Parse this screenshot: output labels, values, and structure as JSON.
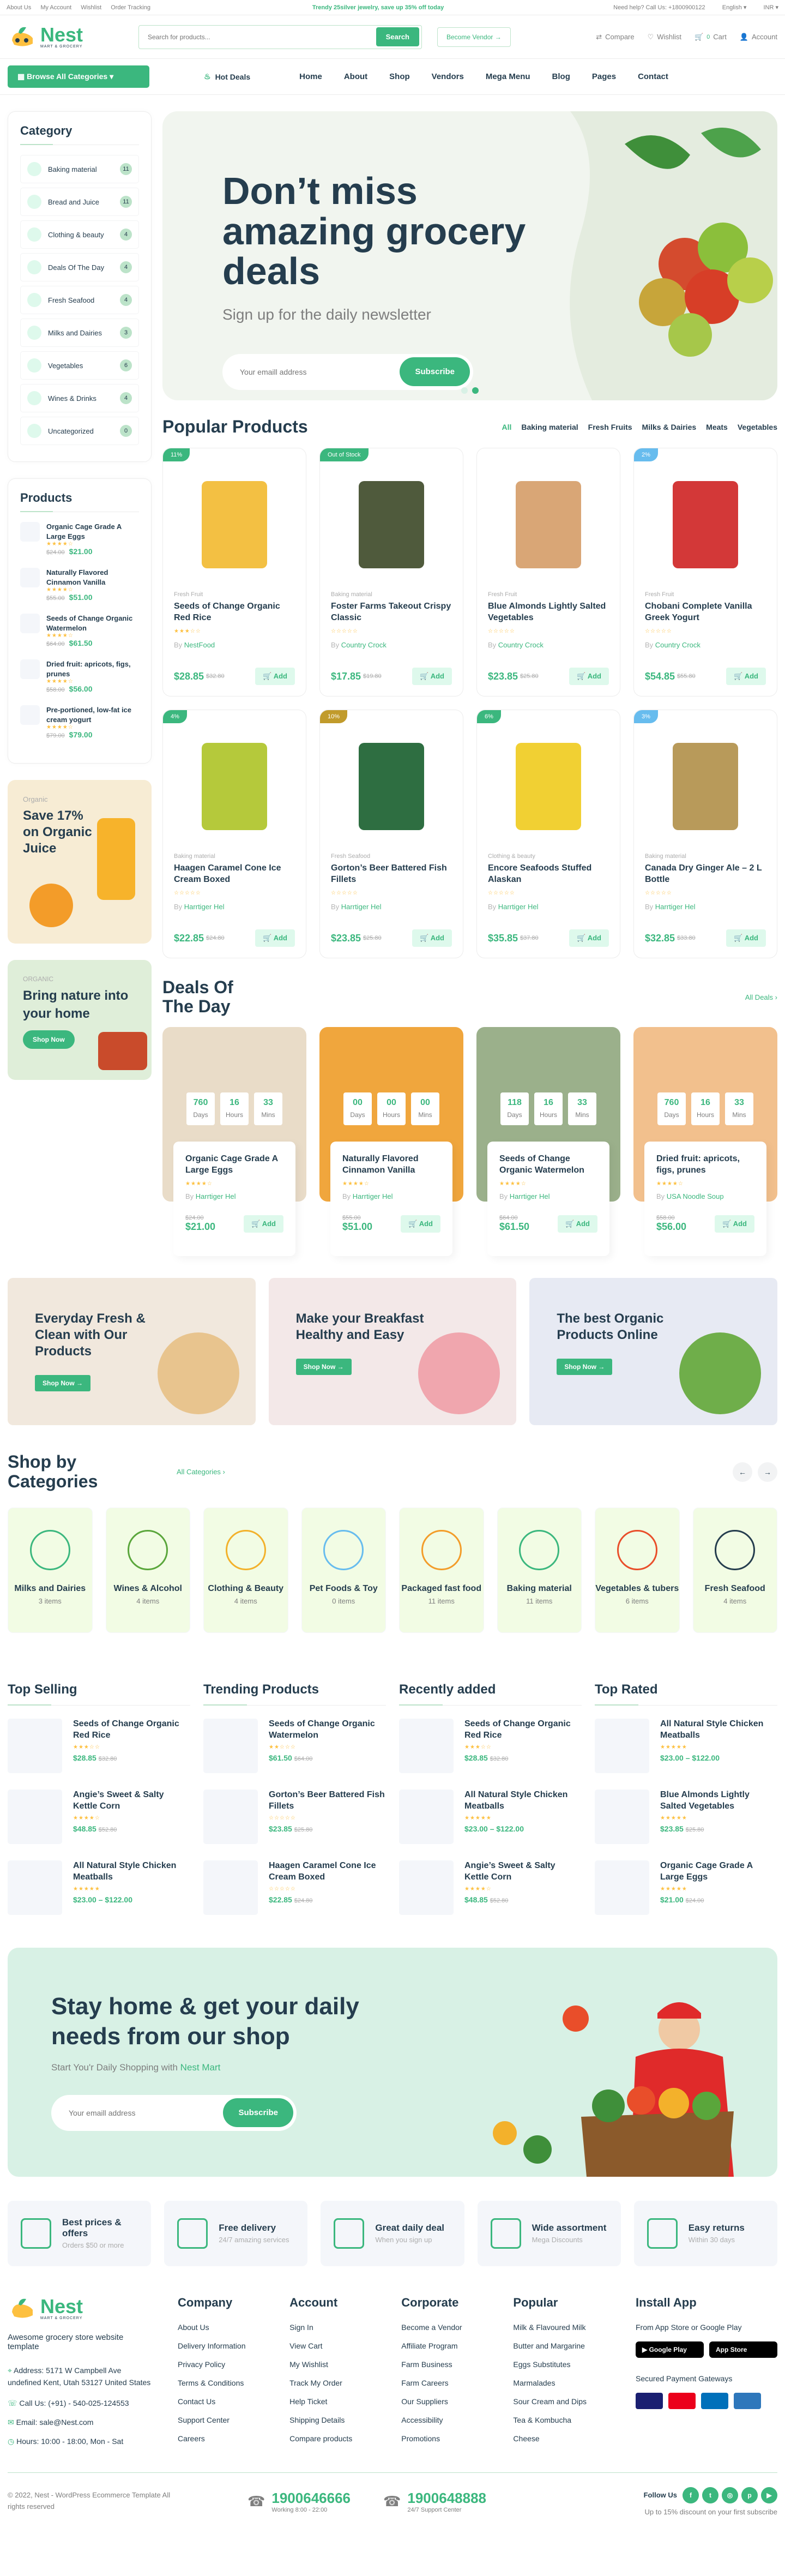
{
  "topbar": {
    "links": [
      "About Us",
      "My Account",
      "Wishlist",
      "Order Tracking"
    ],
    "promo": "Trendy 25silver jewelry, save up 35% off today",
    "help": "Need help? Call Us: +1800900122",
    "lang": "English",
    "currency": "INR"
  },
  "header": {
    "logo": "Nest",
    "logo_sub": "MART & GROCERY",
    "search_placeholder": "Search for products...",
    "search_btn": "Search",
    "vendor_btn": "Become Vendor",
    "actions": [
      {
        "label": "Compare",
        "icon": "compare-icon"
      },
      {
        "label": "Wishlist",
        "icon": "heart-icon"
      },
      {
        "label": "Cart",
        "icon": "cart-icon",
        "count": "0"
      },
      {
        "label": "Account",
        "icon": "user-icon"
      }
    ]
  },
  "nav": {
    "browse": "Browse All Categories",
    "hot": "Hot Deals",
    "items": [
      "Home",
      "About",
      "Shop",
      "Vendors",
      "Mega Menu",
      "Blog",
      "Pages",
      "Contact"
    ]
  },
  "sidebar": {
    "category_title": "Category",
    "categories": [
      {
        "label": "Baking material",
        "count": "11"
      },
      {
        "label": "Bread and Juice",
        "count": "11"
      },
      {
        "label": "Clothing & beauty",
        "count": "4"
      },
      {
        "label": "Deals Of The Day",
        "count": "4"
      },
      {
        "label": "Fresh Seafood",
        "count": "4"
      },
      {
        "label": "Milks and Dairies",
        "count": "3"
      },
      {
        "label": "Vegetables",
        "count": "6"
      },
      {
        "label": "Wines & Drinks",
        "count": "4"
      },
      {
        "label": "Uncategorized",
        "count": "0"
      }
    ],
    "products_title": "Products",
    "products": [
      {
        "name": "Organic Cage Grade A Large Eggs",
        "old": "$24.00",
        "price": "$21.00"
      },
      {
        "name": "Naturally Flavored Cinnamon Vanilla",
        "old": "$55.00",
        "price": "$51.00"
      },
      {
        "name": "Seeds of Change Organic Watermelon",
        "old": "$64.00",
        "price": "$61.50"
      },
      {
        "name": "Dried fruit: apricots, figs, prunes",
        "old": "$58.00",
        "price": "$56.00"
      },
      {
        "name": "Pre-portioned, low-fat ice cream yogurt",
        "old": "$79.00",
        "price": "$79.00"
      }
    ],
    "promo1": {
      "small": "Organic",
      "title": "Save 17% on Organic Juice"
    },
    "promo2": {
      "small": "ORGANIC",
      "title": "Bring nature into your home",
      "btn": "Shop Now"
    }
  },
  "hero": {
    "title": "Don’t miss amazing grocery deals",
    "subtitle": "Sign up for the daily newsletter",
    "placeholder": "Your emaill address",
    "btn": "Subscribe"
  },
  "popular": {
    "title": "Popular Products",
    "filters": [
      "All",
      "Baking material",
      "Fresh Fruits",
      "Milks & Dairies",
      "Meats",
      "Vegetables"
    ],
    "products": [
      {
        "badge": "11%",
        "badge_color": "#3bb77e",
        "cat": "Fresh Fruit",
        "name": "Seeds of Change Organic Red Rice",
        "stars": "★★★☆☆",
        "by": "NestFood",
        "price": "$28.85",
        "old": "$32.80",
        "pkg": "#f3c043"
      },
      {
        "badge": "Out of Stock",
        "badge_color": "#3bb77e",
        "cat": "Baking material",
        "name": "Foster Farms Takeout Crispy Classic",
        "stars": "☆☆☆☆☆",
        "by": "Country Crock",
        "price": "$17.85",
        "old": "$19.80",
        "pkg": "#4f5a3c"
      },
      {
        "badge": "",
        "badge_color": "",
        "cat": "Fresh Fruit",
        "name": "Blue Almonds Lightly Salted Vegetables",
        "stars": "☆☆☆☆☆",
        "by": "Country Crock",
        "price": "$23.85",
        "old": "$25.80",
        "pkg": "#d9a676"
      },
      {
        "badge": "2%",
        "badge_color": "#67bcee",
        "cat": "Fresh Fruit",
        "name": "Chobani Complete Vanilla Greek Yogurt",
        "stars": "☆☆☆☆☆",
        "by": "Country Crock",
        "price": "$54.85",
        "old": "$55.80",
        "pkg": "#d33838"
      },
      {
        "badge": "4%",
        "badge_color": "#3bb77e",
        "cat": "Baking material",
        "name": "Haagen Caramel Cone Ice Cream Boxed",
        "stars": "☆☆☆☆☆",
        "by": "Harrtiger Hel",
        "price": "$22.85",
        "old": "$24.80",
        "pkg": "#b5c93b"
      },
      {
        "badge": "10%",
        "badge_color": "#c19b2b",
        "cat": "Fresh Seafood",
        "name": "Gorton’s Beer Battered Fish Fillets",
        "stars": "☆☆☆☆☆",
        "by": "Harrtiger Hel",
        "price": "$23.85",
        "old": "$25.80",
        "pkg": "#2e6e41"
      },
      {
        "badge": "6%",
        "badge_color": "#3bb77e",
        "cat": "Clothing & beauty",
        "name": "Encore Seafoods Stuffed Alaskan",
        "stars": "☆☆☆☆☆",
        "by": "Harrtiger Hel",
        "price": "$35.85",
        "old": "$37.80",
        "pkg": "#f1d033"
      },
      {
        "badge": "3%",
        "badge_color": "#67bcee",
        "cat": "Baking material",
        "name": "Canada Dry Ginger Ale – 2 L Bottle",
        "stars": "☆☆☆☆☆",
        "by": "Harrtiger Hel",
        "price": "$32.85",
        "old": "$33.80",
        "pkg": "#b89a5a"
      }
    ]
  },
  "deals": {
    "title": "Deals Of The Day",
    "link": "All Deals",
    "items": [
      {
        "d": "760",
        "h": "16",
        "m": "33",
        "name": "Organic Cage Grade A Large Eggs",
        "by": "Harrtiger Hel",
        "old": "$24.00",
        "price": "$21.00",
        "photo": "#e9dcc8"
      },
      {
        "d": "00",
        "h": "00",
        "m": "00",
        "name": "Naturally Flavored Cinnamon Vanilla",
        "by": "Harrtiger Hel",
        "old": "$55.00",
        "price": "$51.00",
        "photo": "#f0a63d"
      },
      {
        "d": "118",
        "h": "16",
        "m": "33",
        "name": "Seeds of Change Organic Watermelon",
        "by": "Harrtiger Hel",
        "old": "$64.00",
        "price": "$61.50",
        "photo": "#9bb08b"
      },
      {
        "d": "760",
        "h": "16",
        "m": "33",
        "name": "Dried fruit: apricots, figs, prunes",
        "by": "USA Noodle Soup",
        "old": "$58.00",
        "price": "$56.00",
        "photo": "#f2c08d"
      }
    ],
    "labels": {
      "days": "Days",
      "hours": "Hours",
      "mins": "Mins",
      "add": "Add",
      "by": "By"
    }
  },
  "banners": [
    {
      "title": "Everyday Fresh & Clean with Our Products",
      "btn": "Shop Now",
      "bg": "#f1e8dd"
    },
    {
      "title": "Make your Breakfast Healthy and Easy",
      "btn": "Shop Now",
      "bg": "#f3e8e8"
    },
    {
      "title": "The best Organic Products Online",
      "btn": "Shop Now",
      "bg": "#e7eaf3"
    }
  ],
  "shop_by": {
    "title": "Shop by Categories",
    "link": "All Categories",
    "items": [
      {
        "name": "Milks and Dairies",
        "count": "3 items",
        "bg": "#f2fce4"
      },
      {
        "name": "Wines & Alcohol",
        "count": "4 items",
        "bg": "#f2fce4"
      },
      {
        "name": "Clothing & Beauty",
        "count": "4 items",
        "bg": "#f2fce4"
      },
      {
        "name": "Pet Foods & Toy",
        "count": "0 items",
        "bg": "#f2fce4"
      },
      {
        "name": "Packaged fast food",
        "count": "11 items",
        "bg": "#f2fce4"
      },
      {
        "name": "Baking material",
        "count": "11 items",
        "bg": "#f2fce4"
      },
      {
        "name": "Vegetables & tubers",
        "count": "6 items",
        "bg": "#f2fce4"
      },
      {
        "name": "Fresh Seafood",
        "count": "4 items",
        "bg": "#f2fce4"
      }
    ]
  },
  "lists": [
    {
      "title": "Top Selling",
      "items": [
        {
          "name": "Seeds of Change Organic Red Rice",
          "price": "$28.85",
          "old": "$32.80",
          "stars": "★★★☆☆"
        },
        {
          "name": "Angie’s Sweet & Salty Kettle Corn",
          "price": "$48.85",
          "old": "$52.80",
          "stars": "★★★★☆"
        },
        {
          "name": "All Natural Style Chicken Meatballs",
          "price": "$23.00 – $122.00",
          "old": "",
          "stars": "★★★★★"
        }
      ]
    },
    {
      "title": "Trending Products",
      "items": [
        {
          "name": "Seeds of Change Organic Watermelon",
          "price": "$61.50",
          "old": "$64.00",
          "stars": "★★☆☆☆"
        },
        {
          "name": "Gorton’s Beer Battered Fish Fillets",
          "price": "$23.85",
          "old": "$25.80",
          "stars": "☆☆☆☆☆"
        },
        {
          "name": "Haagen Caramel Cone Ice Cream Boxed",
          "price": "$22.85",
          "old": "$24.80",
          "stars": "☆☆☆☆☆"
        }
      ]
    },
    {
      "title": "Recently added",
      "items": [
        {
          "name": "Seeds of Change Organic Red Rice",
          "price": "$28.85",
          "old": "$32.80",
          "stars": "★★★☆☆"
        },
        {
          "name": "All Natural Style Chicken Meatballs",
          "price": "$23.00 – $122.00",
          "old": "",
          "stars": "★★★★★"
        },
        {
          "name": "Angie’s Sweet & Salty Kettle Corn",
          "price": "$48.85",
          "old": "$52.80",
          "stars": "★★★★☆"
        }
      ]
    },
    {
      "title": "Top Rated",
      "items": [
        {
          "name": "All Natural Style Chicken Meatballs",
          "price": "$23.00 – $122.00",
          "old": "",
          "stars": "★★★★★"
        },
        {
          "name": "Blue Almonds Lightly Salted Vegetables",
          "price": "$23.85",
          "old": "$25.80",
          "stars": "★★★★★"
        },
        {
          "name": "Organic Cage Grade A Large Eggs",
          "price": "$21.00",
          "old": "$24.00",
          "stars": "★★★★★"
        }
      ]
    }
  ],
  "newsletter": {
    "title": "Stay home & get your daily needs from our shop",
    "subtitle_pre": "Start You'r Daily Shopping with ",
    "subtitle_brand": "Nest Mart",
    "placeholder": "Your emaill address",
    "btn": "Subscribe"
  },
  "features": [
    {
      "title": "Best prices & offers",
      "sub": "Orders $50 or more"
    },
    {
      "title": "Free delivery",
      "sub": "24/7 amazing services"
    },
    {
      "title": "Great daily deal",
      "sub": "When you sign up"
    },
    {
      "title": "Wide assortment",
      "sub": "Mega Discounts"
    },
    {
      "title": "Easy returns",
      "sub": "Within 30 days"
    }
  ],
  "footer": {
    "tagline": "Awesome grocery store website template",
    "address": "Address: 5171 W Campbell Ave undefined Kent, Utah 53127 United States",
    "call": "Call Us: (+91) - 540-025-124553",
    "email": "Email: sale@Nest.com",
    "hours": "Hours: 10:00 - 18:00, Mon - Sat",
    "company": {
      "title": "Company",
      "links": [
        "About Us",
        "Delivery Information",
        "Privacy Policy",
        "Terms & Conditions",
        "Contact Us",
        "Support Center",
        "Careers"
      ]
    },
    "account": {
      "title": "Account",
      "links": [
        "Sign In",
        "View Cart",
        "My Wishlist",
        "Track My Order",
        "Help Ticket",
        "Shipping Details",
        "Compare products"
      ]
    },
    "corporate": {
      "title": "Corporate",
      "links": [
        "Become a Vendor",
        "Affiliate Program",
        "Farm Business",
        "Farm Careers",
        "Our Suppliers",
        "Accessibility",
        "Promotions"
      ]
    },
    "popular": {
      "title": "Popular",
      "links": [
        "Milk & Flavoured Milk",
        "Butter and Margarine",
        "Eggs Substitutes",
        "Marmalades",
        "Sour Cream and Dips",
        "Tea & Kombucha",
        "Cheese"
      ]
    },
    "app": {
      "title": "Install App",
      "sub": "From App Store or Google Play",
      "gp": "Google Play",
      "as": "App Store",
      "pay_title": "Secured Payment Gateways"
    },
    "copyright": "© 2022, Nest - WordPress Ecommerce Template All rights reserved",
    "phone1": "1900646666",
    "phone1_sub": "Working 8:00 - 22:00",
    "phone2": "1900648888",
    "phone2_sub": "24/7 Support Center",
    "follow": "Follow Us",
    "discount": "Up to 15% discount on your first subscribe"
  }
}
